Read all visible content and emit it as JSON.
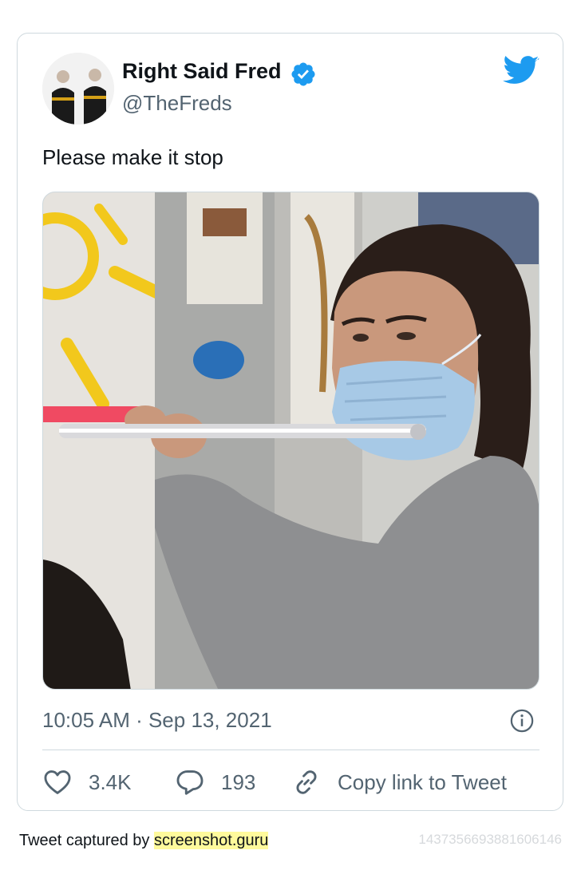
{
  "tweet": {
    "display_name": "Right Said Fred",
    "handle": "@TheFreds",
    "text": "Please make it stop",
    "timestamp": "10:05 AM · Sep 13, 2021",
    "likes": "3.4K",
    "replies": "193",
    "copy_link_label": "Copy link to Tweet",
    "tweet_id": "1437356693881606146"
  },
  "footer": {
    "prefix": "Tweet captured by ",
    "brand": "screenshot.guru"
  },
  "colors": {
    "twitter_blue": "#1d9bf0",
    "secondary_text": "#536471",
    "border": "#cfd9de",
    "highlight": "#fffa9c"
  },
  "icons": [
    "twitter-bird-icon",
    "verified-badge-icon",
    "info-icon",
    "heart-icon",
    "reply-icon",
    "link-icon"
  ]
}
